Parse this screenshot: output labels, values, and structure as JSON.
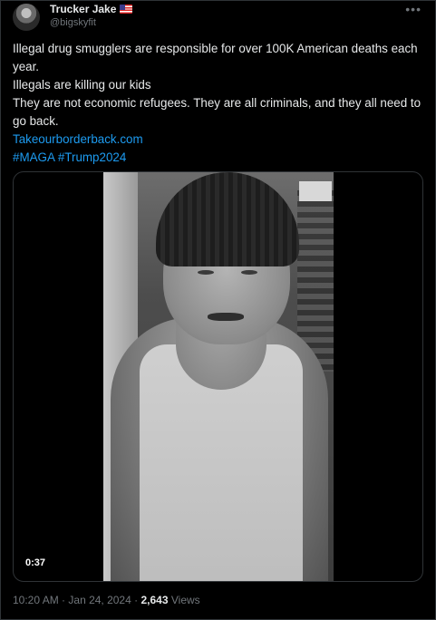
{
  "author": {
    "name": "Trucker Jake",
    "handle": "@bigskyfit",
    "flag_icon": "us-flag-icon"
  },
  "more_icon": "more-icon",
  "tweet": {
    "lines": [
      "Illegal drug smugglers are responsible for over 100K American deaths each year.",
      "Illegals are killing our kids",
      "They are not economic refugees. They are all criminals, and they all need to go back."
    ],
    "link": "Takeourborderback.com",
    "hashtags": "#MAGA #Trump2024"
  },
  "media": {
    "duration": "0:37"
  },
  "meta": {
    "time": "10:20 AM",
    "separator": "·",
    "date": "Jan 24, 2024",
    "views_count": "2,643",
    "views_label": "Views"
  },
  "colors": {
    "background": "#000000",
    "text": "#e7e9ea",
    "secondary": "#71767b",
    "link": "#1d9bf0",
    "border": "#2f3336"
  }
}
